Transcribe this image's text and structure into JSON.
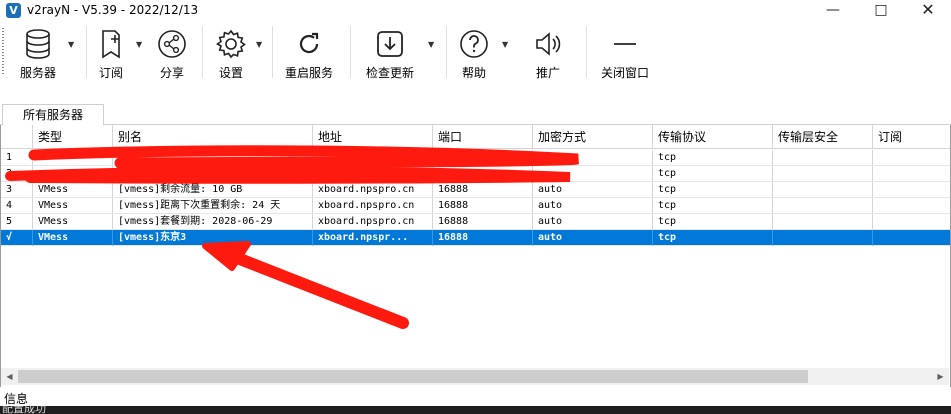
{
  "window": {
    "title": "v2rayN - V5.39 - 2022/12/13",
    "app_icon": "V"
  },
  "toolbar": {
    "servers": "服务器",
    "subscription": "订阅",
    "share": "分享",
    "settings": "设置",
    "restart": "重启服务",
    "check_update": "检查更新",
    "help": "帮助",
    "promote": "推广",
    "close_window": "关闭窗口"
  },
  "tabs": {
    "all_servers": "所有服务器"
  },
  "table": {
    "headers": [
      "",
      "类型",
      "别名",
      "地址",
      "端口",
      "加密方式",
      "传输协议",
      "传输层安全",
      "订阅"
    ],
    "rows": [
      {
        "num": "1",
        "type": "",
        "alias": "",
        "addr": "",
        "port": "",
        "enc": "",
        "net": "tcp"
      },
      {
        "num": "2",
        "type": "",
        "alias": "",
        "addr": "",
        "port": "",
        "enc": "",
        "net": "tcp"
      },
      {
        "num": "3",
        "type": "VMess",
        "alias": "[vmess]剩余流量: 10 GB",
        "addr": "xboard.npspro.cn",
        "port": "16888",
        "enc": "auto",
        "net": "tcp"
      },
      {
        "num": "4",
        "type": "VMess",
        "alias": "[vmess]距离下次重置剩余: 24 天",
        "addr": "xboard.npspro.cn",
        "port": "16888",
        "enc": "auto",
        "net": "tcp"
      },
      {
        "num": "5",
        "type": "VMess",
        "alias": "[vmess]套餐到期: 2028-06-29",
        "addr": "xboard.npspro.cn",
        "port": "16888",
        "enc": "auto",
        "net": "tcp"
      },
      {
        "num": "√",
        "type": "VMess",
        "alias": "[vmess]东京3",
        "addr": "xboard.npspr...",
        "port": "16888",
        "enc": "auto",
        "net": "tcp"
      }
    ]
  },
  "info": {
    "label": "信息",
    "status": "配置成功"
  },
  "colors": {
    "selection": "#0078d7",
    "annotation": "#ff1a10"
  }
}
